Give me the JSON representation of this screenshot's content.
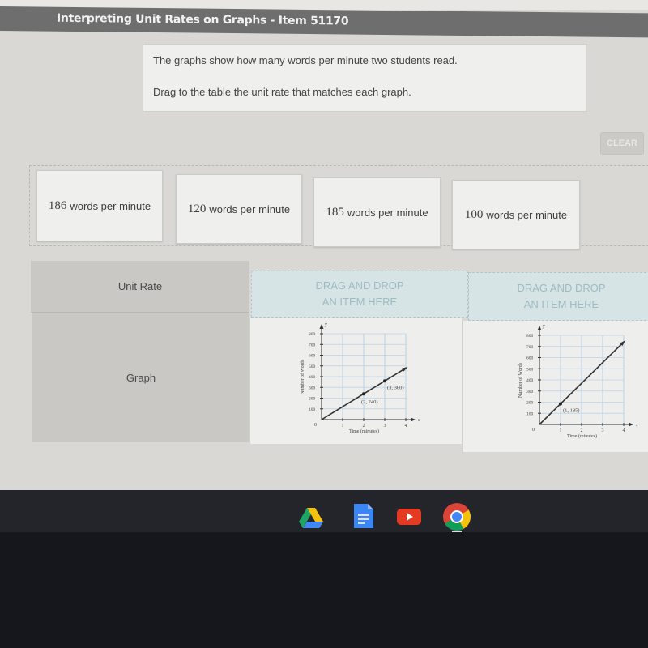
{
  "header": {
    "title": "Interpreting Unit Rates on Graphs - Item 51170"
  },
  "prompt": {
    "line1": "The graphs show how many words per minute two students read.",
    "line2": "Drag to the table the unit rate that matches each graph."
  },
  "toolbar": {
    "clear_label": "CLEAR"
  },
  "answer_bank": [
    {
      "number": "186",
      "unit": "words per minute"
    },
    {
      "number": "120",
      "unit": "words per minute"
    },
    {
      "number": "185",
      "unit": "words per minute"
    },
    {
      "number": "100",
      "unit": "words per minute"
    }
  ],
  "table": {
    "row_labels": {
      "unit_rate": "Unit Rate",
      "graph": "Graph"
    },
    "drop_zones": [
      {
        "line1": "DRAG AND DROP",
        "line2": "AN ITEM HERE"
      },
      {
        "line1": "DRAG AND DROP",
        "line2": "AN ITEM HERE"
      }
    ]
  },
  "chart_data": [
    {
      "type": "line",
      "title": "",
      "xlabel": "Time (minutes)",
      "ylabel": "Number of Words",
      "x_axis_name": "x",
      "y_axis_name": "y",
      "origin_label": "0",
      "xlim": [
        0,
        4
      ],
      "ylim": [
        0,
        800
      ],
      "xticks": [
        "1",
        "2",
        "3",
        "4"
      ],
      "yticks": [
        "100",
        "200",
        "300",
        "400",
        "500",
        "600",
        "700",
        "800"
      ],
      "grid": true,
      "series": [
        {
          "name": "line",
          "x": [
            0,
            4
          ],
          "y": [
            0,
            480
          ]
        }
      ],
      "points": [
        {
          "x": 2,
          "y": 240,
          "label": "(2, 240)"
        },
        {
          "x": 3,
          "y": 360,
          "label": "(3, 360)"
        }
      ]
    },
    {
      "type": "line",
      "title": "",
      "xlabel": "Time (minutes)",
      "ylabel": "Number of Words",
      "x_axis_name": "x",
      "y_axis_name": "y",
      "origin_label": "0",
      "xlim": [
        0,
        4
      ],
      "ylim": [
        0,
        800
      ],
      "xticks": [
        "1",
        "2",
        "3",
        "4"
      ],
      "yticks": [
        "100",
        "200",
        "300",
        "400",
        "500",
        "600",
        "700",
        "800"
      ],
      "grid": true,
      "series": [
        {
          "name": "line",
          "x": [
            0,
            4
          ],
          "y": [
            0,
            740
          ]
        }
      ],
      "points": [
        {
          "x": 1,
          "y": 185,
          "label": "(1, 185)"
        }
      ]
    }
  ],
  "taskbar": {
    "apps": [
      {
        "name": "Google Drive",
        "icon": "drive-icon"
      },
      {
        "name": "Google Docs",
        "icon": "docs-icon"
      },
      {
        "name": "YouTube",
        "icon": "youtube-icon"
      },
      {
        "name": "Chrome",
        "icon": "chrome-icon"
      }
    ]
  }
}
